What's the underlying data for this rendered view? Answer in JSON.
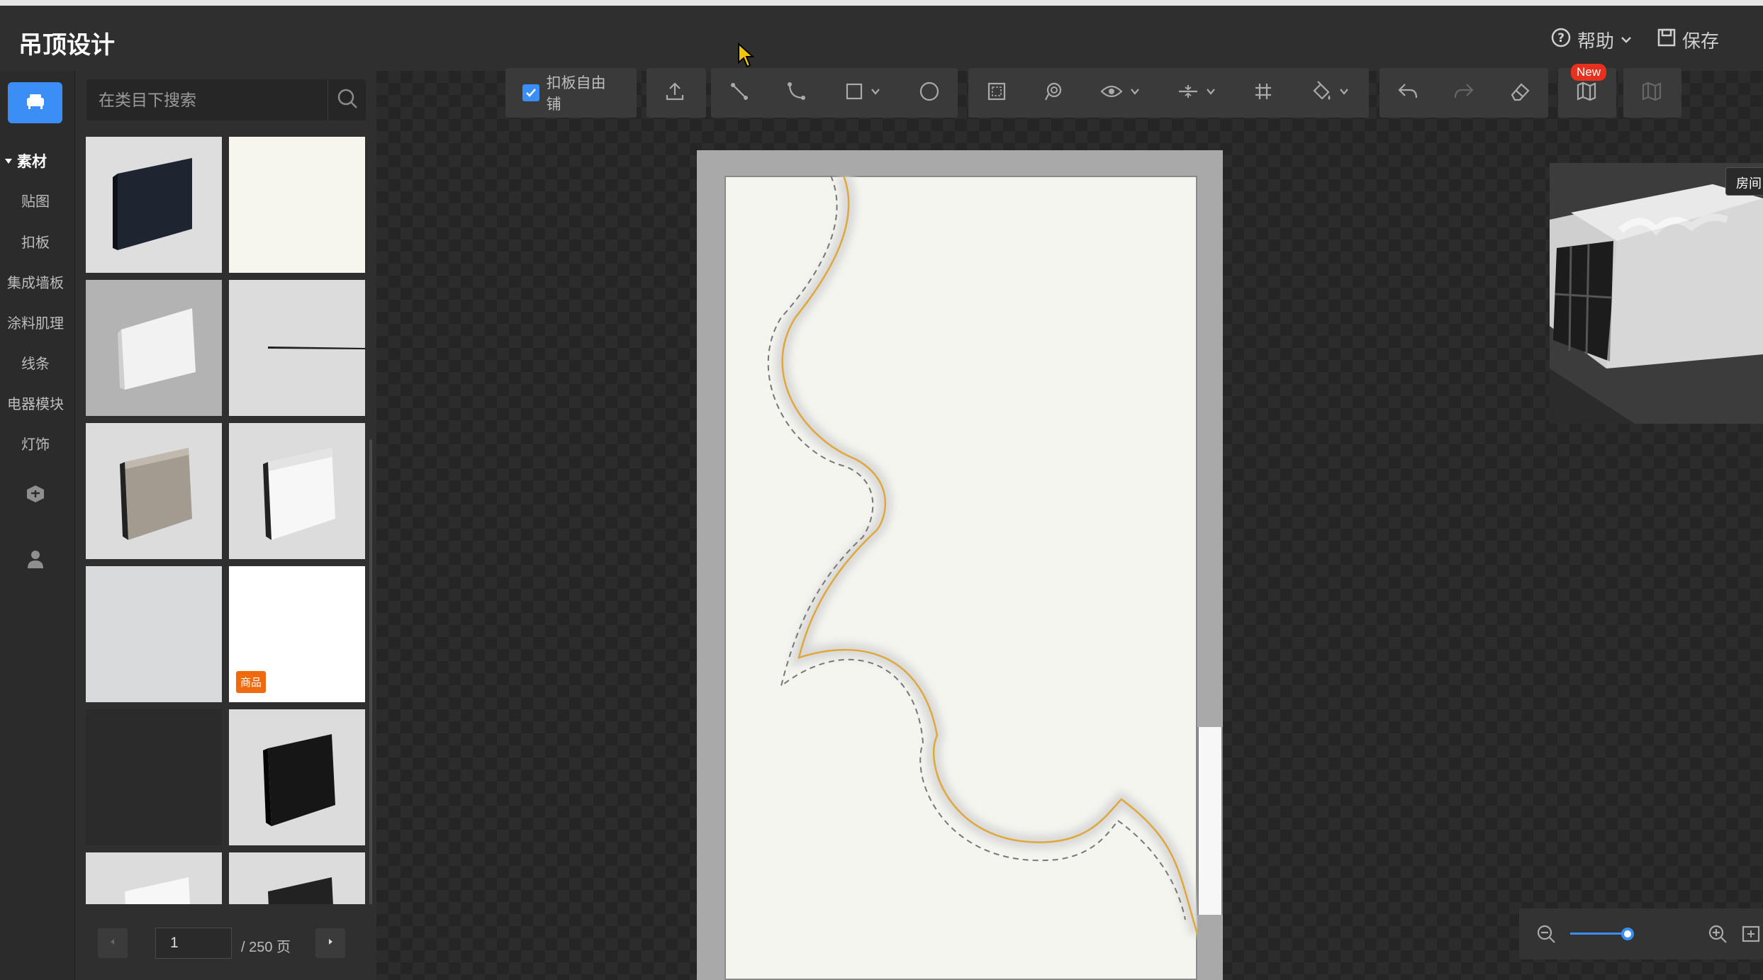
{
  "header": {
    "title": "吊顶设计",
    "help_label": "帮助",
    "save_label": "保存"
  },
  "nav": {
    "section_label": "素材",
    "items": [
      "贴图",
      "扣板",
      "集成墙板",
      "涂料肌理",
      "线条",
      "电器模块",
      "灯饰"
    ]
  },
  "search": {
    "placeholder": "在类目下搜索"
  },
  "thumbnails": [
    {
      "label": "dark baseboard"
    },
    {
      "label": "white panel"
    },
    {
      "label": "white baseboard"
    },
    {
      "label": "thin line"
    },
    {
      "label": "wood molding"
    },
    {
      "label": "white molding"
    },
    {
      "label": "texture"
    },
    {
      "label": "white product",
      "badge": "商品"
    },
    {
      "label": "dark tile"
    },
    {
      "label": "black baseboard"
    },
    {
      "label": "white baseboard 2"
    },
    {
      "label": "dark baseboard 2"
    }
  ],
  "pagination": {
    "current": "1",
    "total_label": "/ 250 页"
  },
  "toolbar": {
    "free_tile_label": "扣板自由铺",
    "free_tile_checked": true,
    "new_badge": "New"
  },
  "preview": {
    "tab_label": "房间"
  },
  "zoom": {
    "level": 0.4
  },
  "colors": {
    "accent": "#3a8ef6",
    "badge": "#f26a10",
    "new_badge": "#e8301f"
  }
}
